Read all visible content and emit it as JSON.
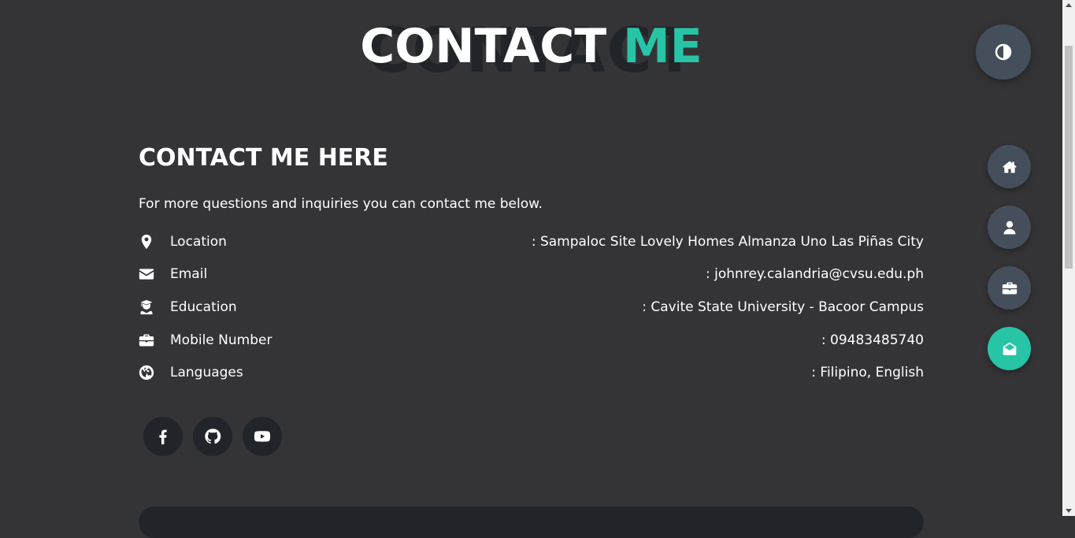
{
  "section": {
    "title_background": "CONTACT",
    "title_main": "CONTACT",
    "title_accent": "ME"
  },
  "contact": {
    "heading": "CONTACT ME HERE",
    "intro": "For more questions and inquiries you can contact me below.",
    "items": [
      {
        "icon": "map-pin-icon",
        "label": "Location",
        "value": ": Sampaloc Site Lovely Homes Almanza Uno Las Piñas City"
      },
      {
        "icon": "envelope-icon",
        "label": "Email",
        "value": ": johnrey.calandria@cvsu.edu.ph"
      },
      {
        "icon": "graduate-icon",
        "label": "Education",
        "value": ": Cavite State University - Bacoor Campus"
      },
      {
        "icon": "briefcase-icon",
        "label": "Mobile Number",
        "value": ": 09483485740"
      },
      {
        "icon": "globe-icon",
        "label": "Languages",
        "value": ": Filipino, English"
      }
    ]
  },
  "socials": [
    {
      "icon": "facebook-icon"
    },
    {
      "icon": "github-icon"
    },
    {
      "icon": "youtube-icon"
    }
  ],
  "nav": [
    {
      "icon": "home-icon",
      "active": false
    },
    {
      "icon": "user-icon",
      "active": false
    },
    {
      "icon": "briefcase-icon",
      "active": false
    },
    {
      "icon": "envelope-open-icon",
      "active": true
    }
  ],
  "theme_toggle": {
    "icon": "contrast-icon"
  },
  "colors": {
    "background": "#343436",
    "accent": "#27c4a6",
    "button": "#454e5b",
    "dark": "#212529"
  }
}
